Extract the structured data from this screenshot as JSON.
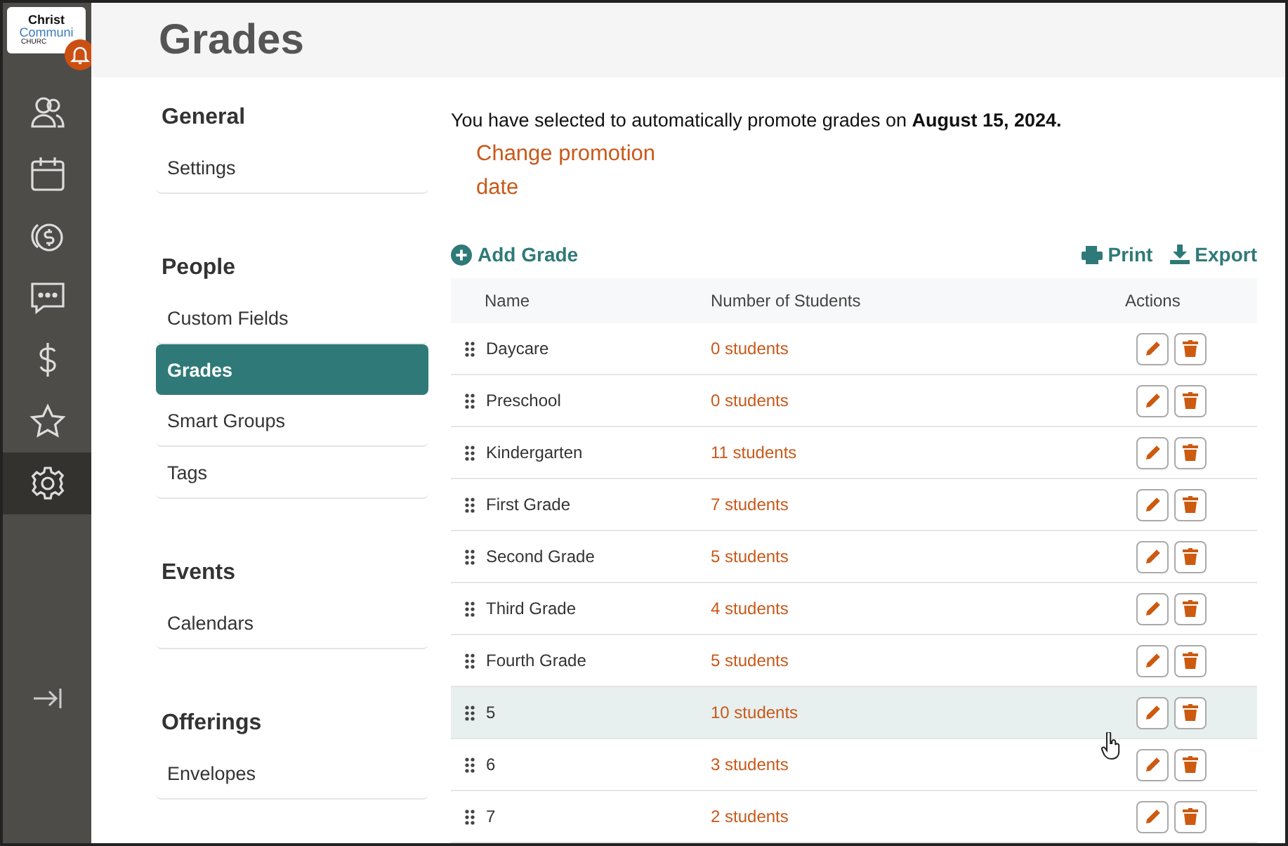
{
  "logo": {
    "lines": [
      "Christ",
      "Communi",
      "CHURC"
    ]
  },
  "sidebar": {
    "items": [
      {
        "selected": false
      },
      {
        "selected": false
      },
      {
        "selected": false
      },
      {
        "selected": false
      },
      {
        "selected": false
      },
      {
        "selected": false
      },
      {
        "selected": true
      }
    ]
  },
  "page": {
    "title": "Grades"
  },
  "nav": [
    {
      "heading": "General",
      "items": [
        {
          "label": "Settings",
          "selected": false
        }
      ]
    },
    {
      "heading": "People",
      "items": [
        {
          "label": "Custom Fields",
          "selected": false
        },
        {
          "label": "Grades",
          "selected": true
        },
        {
          "label": "Smart Groups",
          "selected": false
        },
        {
          "label": "Tags",
          "selected": false
        }
      ]
    },
    {
      "heading": "Events",
      "items": [
        {
          "label": "Calendars",
          "selected": false
        }
      ]
    },
    {
      "heading": "Offerings",
      "items": [
        {
          "label": "Envelopes",
          "selected": false
        }
      ]
    }
  ],
  "notice": {
    "text": "You have selected to automatically promote grades on **August 15, 2024.**",
    "link": "Change promotion date"
  },
  "toolbar": {
    "add": "Add Grade",
    "print": "Print",
    "export": "Export"
  },
  "table": {
    "columns": [
      "Name",
      "Number of Students",
      "Actions"
    ],
    "rows": [
      {
        "name": "Daycare",
        "students": "0 students",
        "highlighted": false
      },
      {
        "name": "Preschool",
        "students": "0 students",
        "highlighted": false
      },
      {
        "name": "Kindergarten",
        "students": "11 students",
        "highlighted": false
      },
      {
        "name": "First Grade",
        "students": "7 students",
        "highlighted": false
      },
      {
        "name": "Second Grade",
        "students": "5 students",
        "highlighted": false
      },
      {
        "name": "Third Grade",
        "students": "4 students",
        "highlighted": false
      },
      {
        "name": "Fourth Grade",
        "students": "5 students",
        "highlighted": false
      },
      {
        "name": "5",
        "students": "10 students",
        "highlighted": true
      },
      {
        "name": "6",
        "students": "3 students",
        "highlighted": false
      },
      {
        "name": "7",
        "students": "2 students",
        "highlighted": false
      }
    ]
  }
}
